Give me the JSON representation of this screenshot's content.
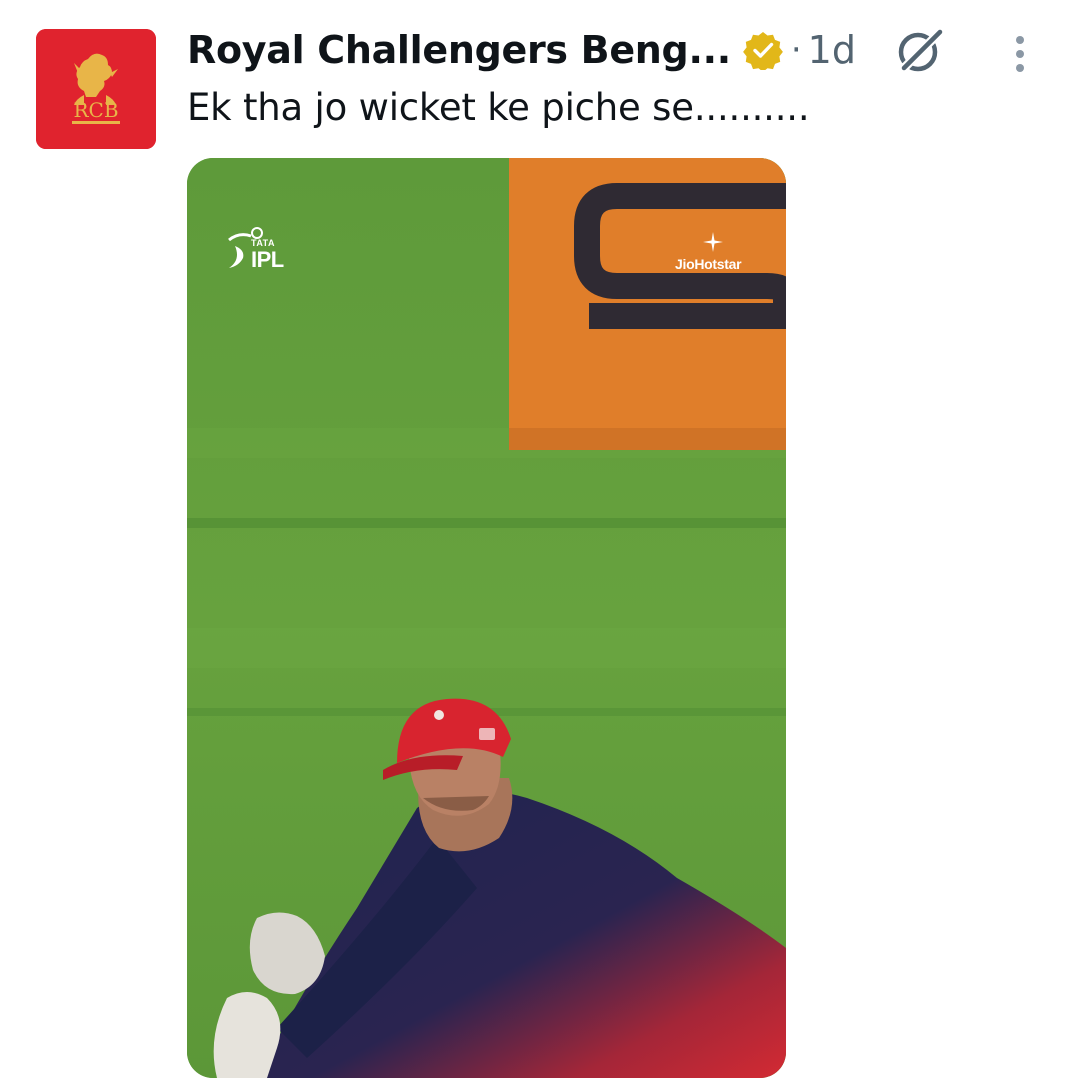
{
  "tweet": {
    "author_name": "Royal Challengers Beng...",
    "verified_badge": "verified-gold-icon",
    "separator": "·",
    "time": "1d",
    "text": "Ek tha jo wicket ke piche se..........",
    "avatar": {
      "monogram": "RCB",
      "icon": "rcb-lion-crest-icon",
      "background": "#e0232e",
      "accent": "#e8b548"
    },
    "actions": {
      "grok_icon": "grok-icon",
      "more_icon": "more-options-icon"
    }
  },
  "media": {
    "type": "video",
    "overlay": {
      "league_small": "TATA",
      "league": "IPL",
      "broadcaster": "JioHotstar"
    },
    "colors": {
      "pitch_green": "#5f9a3b",
      "board_orange": "#e07e2a",
      "cap_red": "#d8242f",
      "jersey_navy": "#1f2450"
    }
  },
  "colors": {
    "text_primary": "#0f1419",
    "text_secondary": "#536471",
    "badge_gold": "#e2b719"
  }
}
